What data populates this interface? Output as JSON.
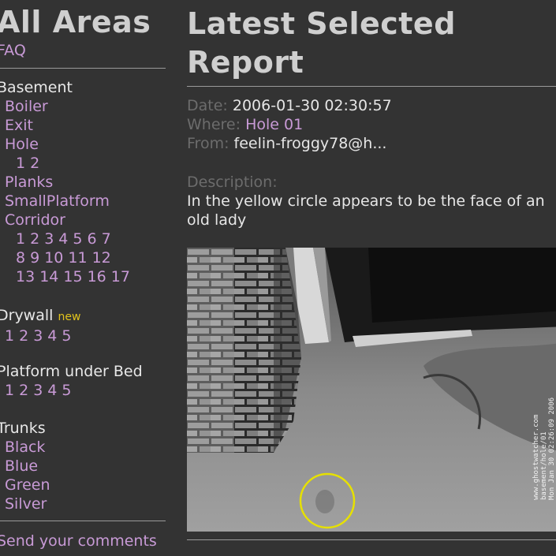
{
  "left": {
    "title": "All Areas",
    "faq": "FAQ",
    "basement": {
      "header": "Basement",
      "items": [
        "Boiler",
        "Exit",
        "Hole"
      ],
      "hole_nums": [
        "1",
        "2"
      ],
      "planks": "Planks",
      "small_platform": "SmallPlatform",
      "corridor": "Corridor",
      "corridor_row1": [
        "1",
        "2",
        "3",
        "4",
        "5",
        "6",
        "7"
      ],
      "corridor_row2": [
        "8",
        "9",
        "10",
        "11",
        "12"
      ],
      "corridor_row3": [
        "13",
        "14",
        "15",
        "16",
        "17"
      ]
    },
    "drywall": {
      "header": "Drywall",
      "badge": "new",
      "nums": [
        "1",
        "2",
        "3",
        "4",
        "5"
      ]
    },
    "platform": {
      "header": "Platform under Bed",
      "nums": [
        "1",
        "2",
        "3",
        "4",
        "5"
      ]
    },
    "trunks": {
      "header": "Trunks",
      "items": [
        "Black",
        "Blue",
        "Green",
        "Silver"
      ]
    },
    "comments_link": "Send your comments"
  },
  "report": {
    "title_line1": "Latest Selected",
    "title_line2": "Report",
    "date_label": "Date:",
    "date_value": "2006-01-30 02:30:57",
    "where_label": "Where:",
    "where_value": "Hole 01",
    "from_label": "From:",
    "from_value": "feelin-froggy78@h...",
    "desc_label": "Description:",
    "desc_value": "In the yellow circle appears to be the face of an old lady",
    "image_stamp_line1": "www.ghostwatcher.com",
    "image_stamp_line2": "basement/hole/01",
    "image_stamp_line3": "Mon Jan 30 02:26:09 2006"
  },
  "colors": {
    "background": "#333333",
    "link": "#c89ad6",
    "badge": "#e0c21c",
    "label": "#6c6c6c",
    "highlight_circle": "#e6e000"
  }
}
